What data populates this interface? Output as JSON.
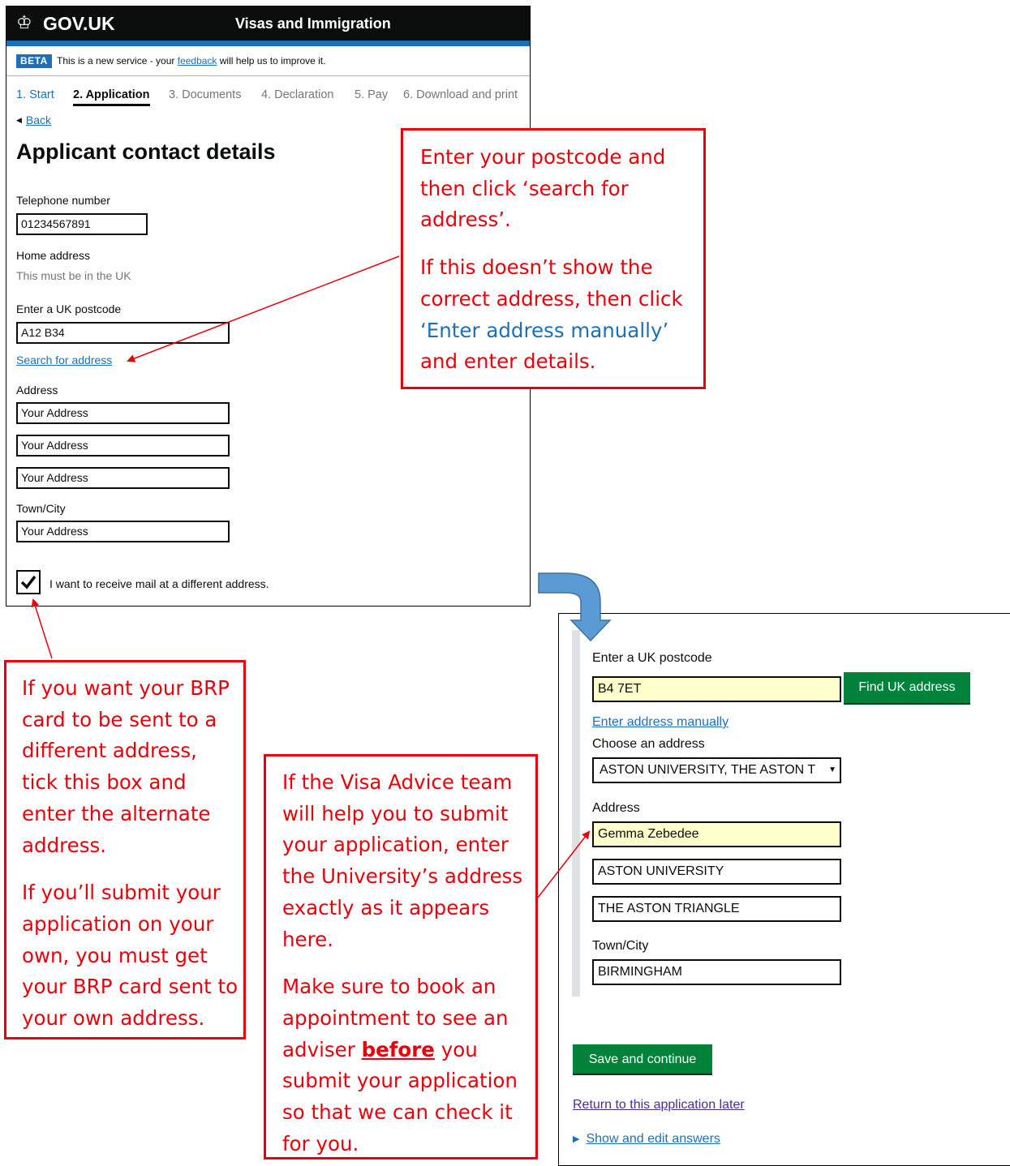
{
  "header": {
    "crown_icon": "crown-icon",
    "logo_text": "GOV.UK",
    "service_name": "Visas and Immigration"
  },
  "beta_banner": {
    "tag": "BETA",
    "text_before": "This is a new service - your ",
    "link": "feedback",
    "text_after": " will help us to improve it."
  },
  "steps": [
    "1. Start",
    "2. Application",
    "3. Documents",
    "4. Declaration",
    "5. Pay",
    "6. Download and print"
  ],
  "current_step": "2. Application",
  "back_link": "Back",
  "page_title": "Applicant contact details",
  "form": {
    "telephone_label": "Telephone number",
    "telephone_value": "01234567891",
    "home_address_label": "Home address",
    "home_address_hint": "This must be in the UK",
    "postcode_label": "Enter a UK postcode",
    "postcode_value": "A12 B34",
    "search_link": "Search for address",
    "address_label": "Address",
    "address_lines": [
      "Your Address",
      "Your Address",
      "Your Address"
    ],
    "town_label": "Town/City",
    "town_value": "Your Address",
    "checkbox_label": "I want to receive mail at a different address.",
    "checkbox_checked": true
  },
  "form2": {
    "postcode_label": "Enter a UK postcode",
    "postcode_value": "B4 7ET",
    "find_button": "Find UK address",
    "manual_link": "Enter address manually",
    "choose_label": "Choose an address",
    "selected_address": "ASTON UNIVERSITY, THE ASTON T",
    "address_label": "Address",
    "address_lines": [
      "Gemma Zebedee",
      "ASTON UNIVERSITY",
      "THE ASTON TRIANGLE"
    ],
    "town_label": "Town/City",
    "town_value": "BIRMINGHAM",
    "save_button": "Save and continue",
    "return_link": "Return to this application later",
    "show_edit_link": "Show and edit answers"
  },
  "callouts": {
    "postcode": {
      "p1": "Enter your postcode and then click ‘search for address’.",
      "p2_before": "If this doesn’t show the correct address, then click ",
      "p2_link": "‘Enter address manually’",
      "p2_after": " and enter details."
    },
    "brp": {
      "p1": "If you want your BRP card to be sent to a different address, tick this box and enter the alternate address.",
      "p2": "If you’ll submit your application on your own, you must get your BRP card sent to your own address."
    },
    "visa_team": {
      "p1": "If the Visa Advice team will help you to submit your application, enter the University’s address exactly as it appears here.",
      "p2_before": "Make sure to book an appointment to see an adviser ",
      "p2_bold": "before",
      "p2_after": " you submit your application so that we can check it for you."
    }
  },
  "colors": {
    "callout_red": "#e8000b",
    "govuk_blue": "#1d70b8",
    "govuk_green": "#00823b",
    "highlight_yellow": "#ffffcc",
    "arrow_blue": "#5b9bd5"
  }
}
